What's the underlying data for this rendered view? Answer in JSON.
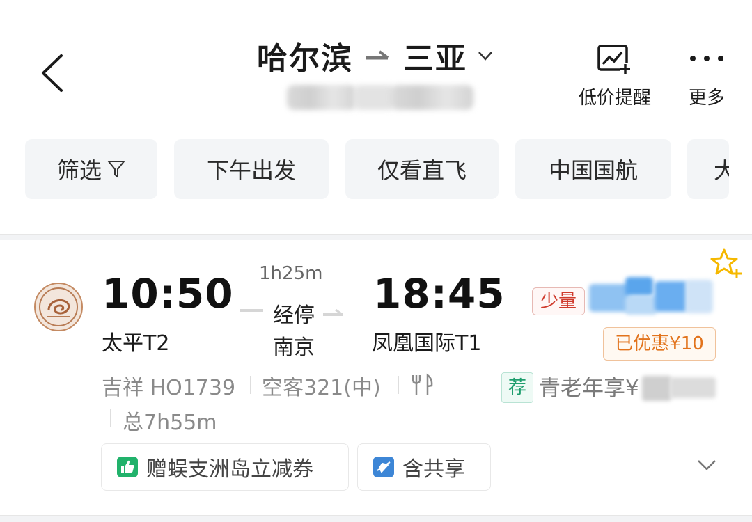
{
  "header": {
    "origin": "哈尔滨",
    "destination": "三亚",
    "alert_label": "低价提醒",
    "more_label": "更多"
  },
  "filters": [
    {
      "label": "筛选"
    },
    {
      "label": "下午出发"
    },
    {
      "label": "仅看直飞"
    },
    {
      "label": "中国国航"
    },
    {
      "label": "大"
    }
  ],
  "flight": {
    "dep_time": "10:50",
    "dep_airport": "太平T2",
    "arr_time": "18:45",
    "arr_airport": "凤凰国际T1",
    "duration": "1h25m",
    "stop_label": "经停",
    "stop_city": "南京",
    "few_seats": "少量",
    "discount": "已优惠¥10",
    "airline_no": "吉祥 HO1739",
    "aircraft": "空客321(中)",
    "total_time": "总7h55m",
    "rec_badge": "荐",
    "elder_price_label": "青老年享¥",
    "tags": [
      "赠蜈支洲岛立减券",
      "含共享"
    ]
  },
  "colors": {
    "accent_red": "#cf3a2c",
    "accent_orange": "#e2731c",
    "green": "#1f9e6e",
    "star": "#f5b800",
    "share_blue": "#3d86d6"
  }
}
